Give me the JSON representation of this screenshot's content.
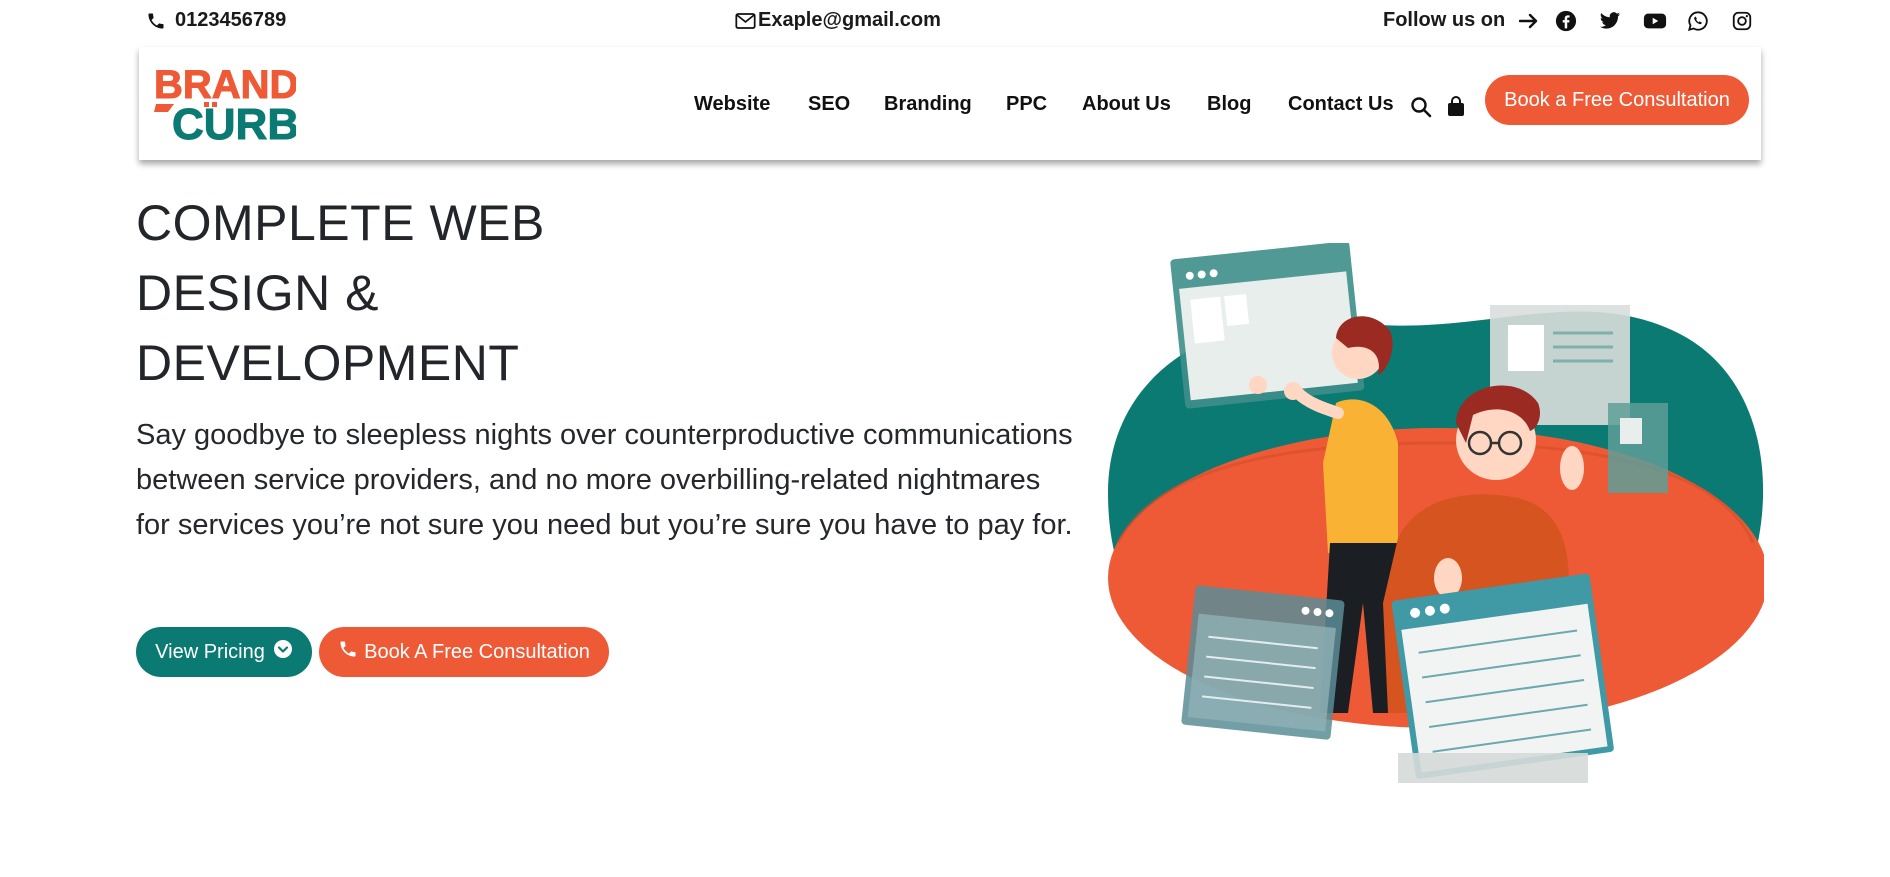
{
  "topbar": {
    "phone": "0123456789",
    "email": "Exaple@gmail.com",
    "follow_label": "Follow us on",
    "social_icons": [
      "facebook-icon",
      "twitter-icon",
      "youtube-icon",
      "whatsapp-icon",
      "instagram-icon"
    ]
  },
  "header": {
    "logo_top": "BRAND",
    "logo_bottom": "CURB",
    "nav": [
      "Website",
      "SEO",
      "Branding",
      "PPC",
      "About Us",
      "Blog",
      "Contact Us"
    ],
    "cta_label": "Book a Free Consultation"
  },
  "hero": {
    "title_lines": [
      "COMPLETE WEB",
      "DESIGN &",
      "DEVELOPMENT"
    ],
    "description": "Say goodbye to sleepless nights over counterproductive communications between service providers, and no more overbilling-related nightmares for services you’re not sure you need but you’re sure you have to pay for.",
    "btn_pricing": "View Pricing",
    "btn_consult": "Book A Free Consultation"
  },
  "colors": {
    "brand_orange": "#ee5a36",
    "brand_teal": "#0b7a73",
    "text_dark": "#22252a"
  }
}
